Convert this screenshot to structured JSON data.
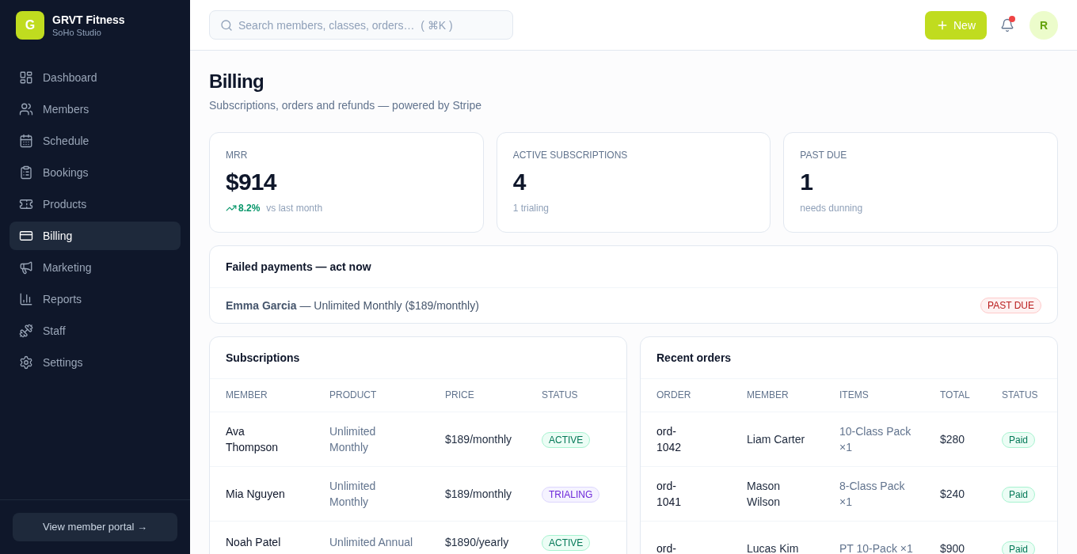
{
  "sidebar": {
    "brand": {
      "initial": "G",
      "name": "GRVT Fitness",
      "subtitle": "SoHo Studio"
    },
    "nav": [
      {
        "label": "Dashboard",
        "selected": false
      },
      {
        "label": "Members",
        "selected": false
      },
      {
        "label": "Schedule",
        "selected": false
      },
      {
        "label": "Bookings",
        "selected": false
      },
      {
        "label": "Products",
        "selected": false
      },
      {
        "label": "Billing",
        "selected": true
      },
      {
        "label": "Marketing",
        "selected": false
      },
      {
        "label": "Reports",
        "selected": false
      },
      {
        "label": "Staff",
        "selected": false
      },
      {
        "label": "Settings",
        "selected": false
      }
    ],
    "portal_button": "View member portal →"
  },
  "topbar": {
    "search": {
      "placeholder": "Search members, classes, orders…  ( ⌘K )"
    },
    "new_button": "New",
    "notifications": {
      "unread": true
    },
    "avatar": "R"
  },
  "page": {
    "title": "Billing",
    "subtitle": "Subscriptions, orders and refunds — powered by Stripe"
  },
  "stats": [
    {
      "label": "MRR",
      "value": "$914",
      "trend": "8.2%",
      "note": "vs last month"
    },
    {
      "label": "ACTIVE SUBSCRIPTIONS",
      "value": "4",
      "note": "1 trialing"
    },
    {
      "label": "PAST DUE",
      "value": "1",
      "note": "needs dunning"
    }
  ],
  "failed_payments": {
    "title": "Failed payments — act now",
    "rows": [
      {
        "text": "**Emma Garcia** — Unlimited Monthly ($189/monthly)",
        "status": {
          "text": "PAST DUE",
          "color": "#b91c1c"
        }
      }
    ]
  },
  "subscriptions": {
    "title": "Subscriptions",
    "columns": [
      "MEMBER",
      "PRODUCT",
      "PRICE",
      "STATUS"
    ],
    "rows": [
      {
        "member": "Ava Thompson",
        "product": "Unlimited Monthly",
        "price": "$189/monthly",
        "status": {
          "text": "ACTIVE",
          "color": "#047857"
        }
      },
      {
        "member": "Mia Nguyen",
        "product": "Unlimited Monthly",
        "price": "$189/monthly",
        "status": {
          "text": "TRIALING",
          "color": "#6d28d9"
        }
      },
      {
        "member": "Noah Patel",
        "product": "Unlimited Annual",
        "price": "$1890/yearly",
        "status": {
          "text": "ACTIVE",
          "color": "#047857"
        }
      }
    ]
  },
  "orders": {
    "title": "Recent orders",
    "columns": [
      "ORDER",
      "MEMBER",
      "ITEMS",
      "TOTAL",
      "STATUS"
    ],
    "rows": [
      {
        "order": "ord-1042",
        "member": "Liam Carter",
        "items": "10-Class Pack ×1",
        "total": "$280",
        "status": {
          "text": "Paid",
          "color": "#047857"
        }
      },
      {
        "order": "ord-1041",
        "member": "Mason Wilson",
        "items": "8-Class Pack ×1",
        "total": "$240",
        "status": {
          "text": "Paid",
          "color": "#047857"
        }
      },
      {
        "order": "ord-",
        "member": "Lucas Kim",
        "items": "PT 10-Pack ×1",
        "total": "$900",
        "status": {
          "text": "Paid",
          "color": "#047857"
        }
      }
    ]
  }
}
